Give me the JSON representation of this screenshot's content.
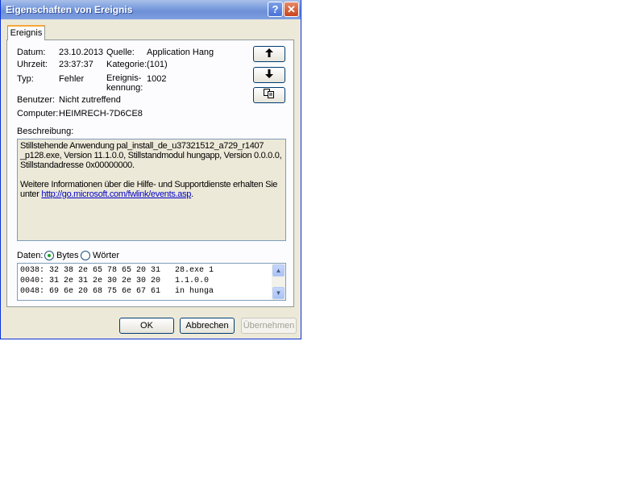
{
  "window": {
    "title": "Eigenschaften von Ereignis"
  },
  "tab": {
    "label": "Ereignis"
  },
  "fields": {
    "datum_label": "Datum:",
    "datum_value": "23.10.2013",
    "quelle_label": "Quelle:",
    "quelle_value": "Application Hang",
    "uhrzeit_label": "Uhrzeit:",
    "uhrzeit_value": "23:37:37",
    "kategorie_label": "Kategorie:",
    "kategorie_value": "(101)",
    "typ_label": "Typ:",
    "typ_value": "Fehler",
    "kennung_label_1": "Ereignis-",
    "kennung_label_2": "kennung:",
    "kennung_value": "1002",
    "benutzer_label": "Benutzer:",
    "benutzer_value": "Nicht zutreffend",
    "computer_label": "Computer:",
    "computer_value": "HEIMRECH-7D6CE8"
  },
  "side_buttons": {
    "up_icon": "arrow-up-icon",
    "down_icon": "arrow-down-icon",
    "copy_icon": "copy-icon"
  },
  "description": {
    "label": "Beschreibung:",
    "text1": "Stillstehende Anwendung pal_install_de_u37321512_a729_r1407 _p128.exe, Version 11.1.0.0, Stillstandmodul hungapp, Version 0.0.0.0, Stillstandadresse 0x00000000.",
    "text2_prefix": "Weitere Informationen über die Hilfe- und Supportdienste erhalten Sie unter ",
    "link": "http://go.microsoft.com/fwlink/events.asp",
    "text2_suffix": "."
  },
  "data_section": {
    "label": "Daten:",
    "option_bytes": "Bytes",
    "option_words": "Wörter",
    "selected": "Bytes",
    "lines": [
      "0038: 32 38 2e 65 78 65 20 31   28.exe 1",
      "0040: 31 2e 31 2e 30 2e 30 20   1.1.0.0 ",
      "0048: 69 6e 20 68 75 6e 67 61   in hunga"
    ]
  },
  "buttons": {
    "ok": "OK",
    "cancel": "Abbrechen",
    "apply": "Übernehmen"
  },
  "colors": {
    "titlebar": "#7d9fdf",
    "dialog_bg": "#ece9d8",
    "tab_accent": "#f6a83a",
    "link": "#0000cc"
  }
}
